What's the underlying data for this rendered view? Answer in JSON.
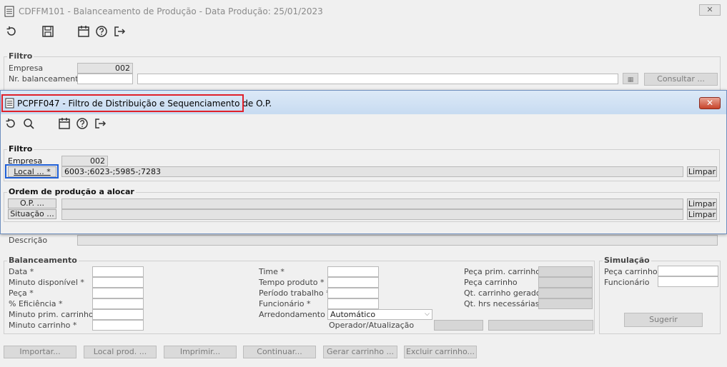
{
  "main": {
    "title": "CDFFM101 - Balanceamento de Produção - Data Produção:  25/01/2023",
    "close_glyph": "✕",
    "filtro": {
      "title": "Filtro",
      "empresa_label": "Empresa",
      "empresa_value": "002",
      "nr_label": "Nr. balanceamento",
      "consultar_label": "Consultar ..."
    },
    "descricao_label": "Descrição",
    "balanceamento": {
      "title": "Balanceamento",
      "data_label": "Data *",
      "minuto_disp_label": "Minuto disponível *",
      "peca_label": "Peça *",
      "eficiencia_label": "% Eficiência *",
      "minuto_prim_label": "Minuto prim. carrinho *",
      "minuto_carrinho_label": "Minuto carrinho *",
      "time_label": "Time *",
      "tempo_produto_label": "Tempo produto *",
      "periodo_label": "Período trabalho *",
      "funcionario_label": "Funcionário *",
      "arredondamento_label": "Arredondamento",
      "arredondamento_value": "Automático",
      "operador_label": "Operador/Atualização",
      "peca_prim_label": "Peça prim. carrinho",
      "peca_carrinho_label": "Peça carrinho",
      "qt_gerado_label": "Qt. carrinho gerado",
      "qt_hrs_label": "Qt. hrs necessárias"
    },
    "simulacao": {
      "title": "Simulação",
      "peca_carrinho_label": "Peça carrinho",
      "funcionario_label": "Funcionário",
      "sugerir_label": "Sugerir"
    },
    "bottom_buttons": [
      "Importar...",
      "Local prod. ...",
      "Imprimir...",
      "Continuar...",
      "Gerar carrinho ...",
      "Excluir carrinho..."
    ]
  },
  "dialog": {
    "title": "PCPFF047 - Filtro de Distribuição e Sequenciamento de O.P.",
    "close_glyph": "✕",
    "filtro": {
      "title": "Filtro",
      "empresa_label": "Empresa",
      "empresa_value": "002",
      "local_button": "Local ... *",
      "local_value": "6003-;6023-;5985-;7283",
      "limpar_label": "Limpar"
    },
    "ordem": {
      "title": "Ordem de produção a alocar",
      "op_button": "O.P. ...",
      "situacao_button": "Situação ...",
      "limpar_label": "Limpar"
    }
  },
  "colors": {
    "highlight": "#e0202a",
    "dialog_title_bg": "#c7dbf1",
    "window_bg": "#f0f0f0"
  }
}
